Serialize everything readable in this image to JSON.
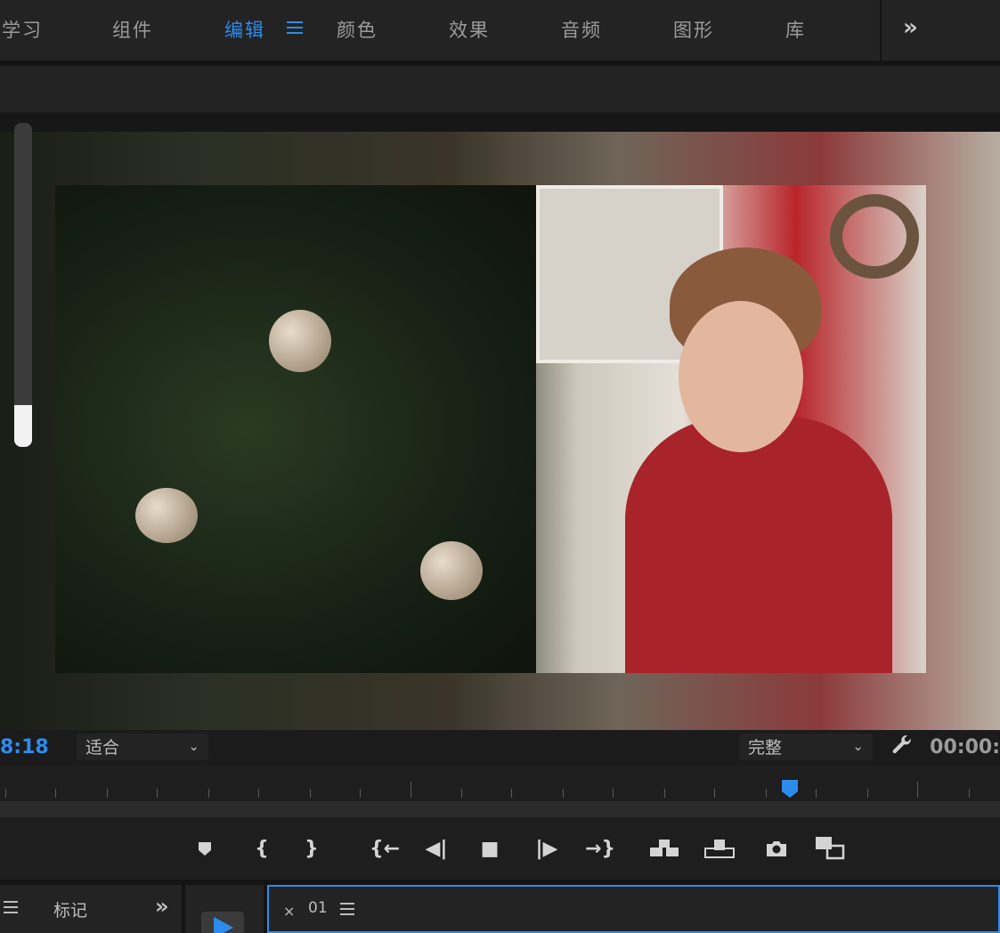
{
  "workspaces": {
    "items": [
      "学习",
      "组件",
      "编辑",
      "颜色",
      "效果",
      "音频",
      "图形",
      "库"
    ],
    "active": "编辑",
    "overflow": "»"
  },
  "program_monitor": {
    "volume_level": 0.13,
    "playhead_position": 0.79
  },
  "controls": {
    "timecode_left": "8:18",
    "zoom_select": "适合",
    "resolution_select": "完整",
    "timecode_right": "00:00:",
    "caret": "⌄"
  },
  "transport": {
    "mark_button": "⯆",
    "mark_in": "{",
    "mark_out": "}",
    "go_to_in": "{←",
    "step_back": "◀|",
    "stop": "■",
    "step_forward": "|▶",
    "go_to_out": "→}",
    "camera": "📷"
  },
  "bottom": {
    "markers_tab": "标记",
    "overflow": "»",
    "close_tab": "×",
    "sequence_tab": "01"
  },
  "colors": {
    "accent": "#2d8ceb",
    "panel_bg": "#232323"
  }
}
